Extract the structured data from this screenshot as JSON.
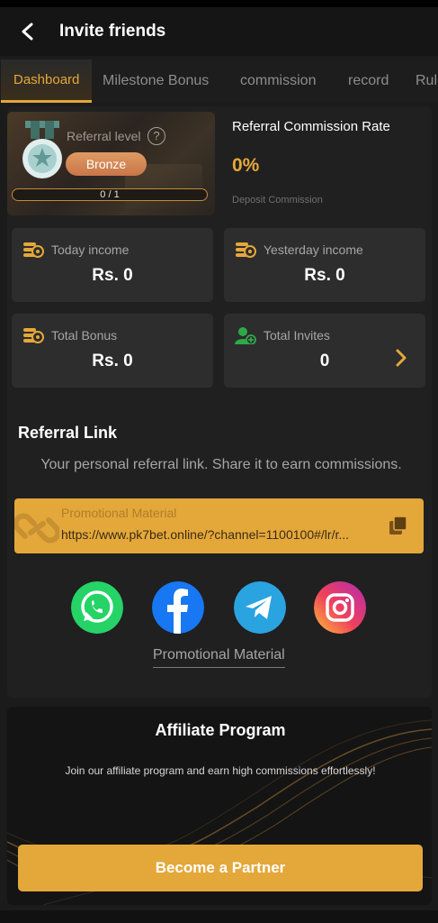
{
  "header": {
    "title": "Invite friends"
  },
  "tabs": [
    {
      "label": "Dashboard",
      "active": true
    },
    {
      "label": "Milestone Bonus"
    },
    {
      "label": "commission"
    },
    {
      "label": "record"
    },
    {
      "label": "Rul"
    }
  ],
  "level": {
    "label": "Referral level",
    "help": "?",
    "badge": "Bronze",
    "progress_text": "0 / 1",
    "progress_fraction": 0
  },
  "rate": {
    "title": "Referral Commission Rate",
    "value": "0%",
    "subtitle": "Deposit Commission"
  },
  "stats": [
    {
      "label": "Today income",
      "value": "Rs. 0",
      "icon": "coin-stack-icon"
    },
    {
      "label": "Yesterday income",
      "value": "Rs. 0",
      "icon": "coin-stack-icon"
    },
    {
      "label": "Total Bonus",
      "value": "Rs. 0",
      "icon": "coin-stack-icon"
    },
    {
      "label": "Total Invites",
      "value": "0",
      "icon": "user-add-icon"
    }
  ],
  "referral": {
    "title": "Referral Link",
    "description": "Your personal referral link. Share it to earn commissions.",
    "promo_title": "Promotional Material",
    "url": "https://www.pk7bet.online/?channel=1100100#/lr/r...",
    "promo_link": "Promotional Material"
  },
  "social": [
    "whatsapp-icon",
    "facebook-icon",
    "telegram-icon",
    "instagram-icon"
  ],
  "affiliate": {
    "title": "Affiliate Program",
    "description": "Join our affiliate program and earn high commissions effortlessly!",
    "button": "Become a Partner"
  },
  "colors": {
    "accent": "#e4a83a",
    "background": "#1b1b1b",
    "card": "#2d2d2d",
    "badge": "#d98a5a"
  }
}
